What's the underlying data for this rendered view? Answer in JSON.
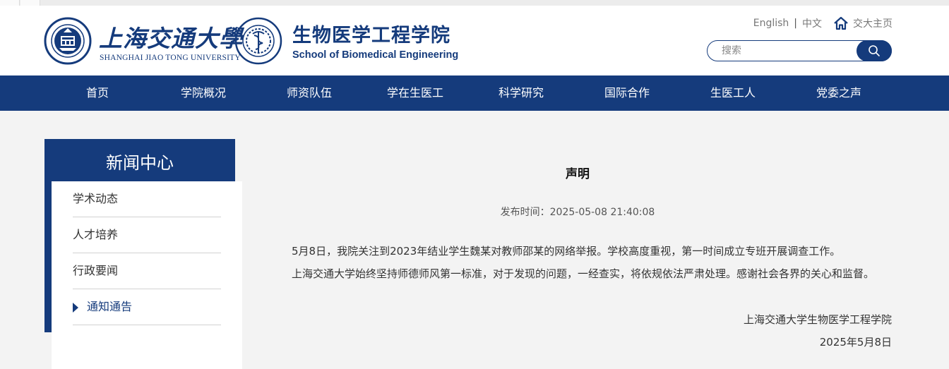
{
  "header": {
    "university_name_cn": "上海交通大學",
    "university_name_en": "SHANGHAI JIAO TONG UNIVERSITY",
    "school_name_cn": "生物医学工程学院",
    "school_name_en": "School of Biomedical Engineering",
    "lang_english": "English",
    "lang_separator": "|",
    "lang_chinese": "中文",
    "home_link": "交大主页",
    "search_placeholder": "搜索"
  },
  "nav": {
    "items": [
      "首页",
      "学院概况",
      "师资队伍",
      "学在生医工",
      "科学研究",
      "国际合作",
      "生医工人",
      "党委之声"
    ]
  },
  "sidebar": {
    "title": "新闻中心",
    "items": [
      {
        "label": "学术动态",
        "active": false
      },
      {
        "label": "人才培养",
        "active": false
      },
      {
        "label": "行政要闻",
        "active": false
      },
      {
        "label": "通知通告",
        "active": true
      }
    ]
  },
  "article": {
    "title": "声明",
    "meta": "发布时间：2025-05-08 21:40:08",
    "paragraphs": [
      "5月8日，我院关注到2023年结业学生魏某对教师邵某的网络举报。学校高度重视，第一时间成立专班开展调查工作。",
      "上海交通大学始终坚持师德师风第一标准，对于发现的问题，一经查实，将依规依法严肃处理。感谢社会各界的关心和监督。"
    ],
    "signature": "上海交通大学生物医学工程学院",
    "date": "2025年5月8日"
  },
  "colors": {
    "brand_blue": "#153b7c",
    "page_background": "#f3f3f3"
  },
  "icons": {
    "home": "home-icon",
    "search": "search-icon",
    "active_marker": "triangle-right-icon"
  }
}
